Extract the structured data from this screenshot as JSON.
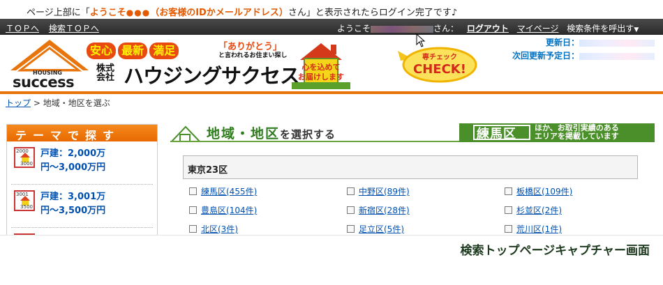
{
  "banner_note": {
    "prefix": "ページ上部に「",
    "highlight": "ようこそ",
    "dots": "●●●",
    "highlight2": "（お客様のIDかメールアドレス）",
    "suffix": "さん」と表示されたらログイン完了です♪"
  },
  "topnav": {
    "top_link": "ＴＯＰへ",
    "search_top_link": "検索ＴＯＰへ",
    "welcome": "ようこそ",
    "san": "さん：",
    "logout": "ログアウト",
    "mypage": "マイページ",
    "call_conditions": "検索条件を呼出す",
    "dropdown_arrow": "▼"
  },
  "header": {
    "logo_housing": "HOUSING",
    "logo_success": "success",
    "badges": [
      "安心",
      "最新",
      "満足"
    ],
    "kaisha_line1": "株式",
    "kaisha_line2": "会社",
    "company_name": "ハウジングサクセス",
    "catch1": "「ありがとう」",
    "catch2": "と言われるお住まい探し",
    "sign_line1": "心を込めて",
    "sign_line2": "お届けします",
    "check_small": "専チェック",
    "check_big": "CHECK!",
    "updated_label": "更新日：",
    "next_update_label": "次回更新予定日："
  },
  "breadcrumb": {
    "top": "トップ",
    "separator": " > ",
    "current": "地域・地区を選ぶ"
  },
  "sidebar": {
    "title": "テーマで探す",
    "items": [
      {
        "icon_top": "2000",
        "icon_bottom": "3000",
        "line1": "戸建：2,000万",
        "line2": "円～3,000万円"
      },
      {
        "icon_top": "3001",
        "icon_bottom": "3500",
        "line1": "戸建：3,001万",
        "line2": "円～3,500万円"
      }
    ]
  },
  "section": {
    "title_main": "地域・地区",
    "title_sub": "を選択する",
    "area_name": "練馬区",
    "area_desc_line1": "ほか、お取引実績のある",
    "area_desc_line2": "エリアを掲載しています"
  },
  "ward_group": {
    "title": "東京23区",
    "wards": [
      "練馬区(455件)",
      "中野区(89件)",
      "板橋区(109件)",
      "豊島区(104件)",
      "新宿区(28件)",
      "杉並区(2件)",
      "北区(3件)",
      "足立区(5件)",
      "荒川区(1件)"
    ]
  },
  "caption": "検索トップページキャプチャー画面",
  "colors": {
    "accent_orange": "#e8740c",
    "link_blue": "#0050b0",
    "green": "#4a8f2a",
    "update_blue": "#0072c6"
  }
}
